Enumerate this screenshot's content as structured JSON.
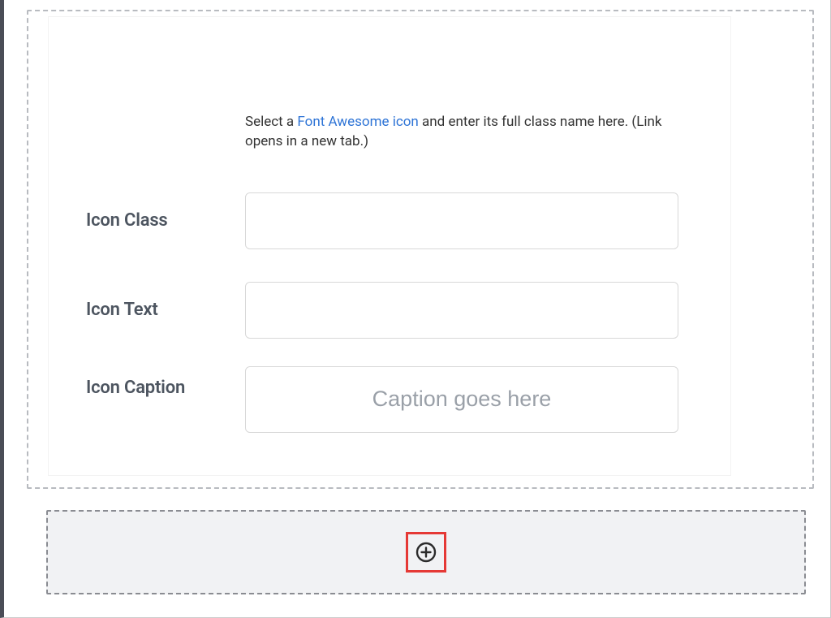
{
  "help": {
    "prefix": "Select a ",
    "link_text": "Font Awesome icon",
    "suffix": " and enter its full class name here. (Link opens in a new tab.)"
  },
  "fields": {
    "icon_class": {
      "label": "Icon Class",
      "value": "",
      "placeholder": ""
    },
    "icon_text": {
      "label": "Icon Text",
      "value": "",
      "placeholder": ""
    },
    "icon_caption": {
      "label": "Icon Caption",
      "value": "",
      "placeholder": "Caption goes here"
    }
  },
  "add_block": {
    "icon_name": "plus-circle-icon"
  }
}
